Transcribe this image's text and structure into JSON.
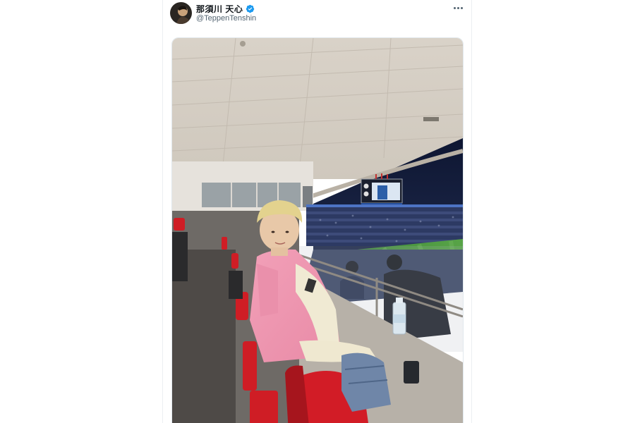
{
  "author": {
    "display_name": "那須川 天心",
    "handle": "@TeppenTenshin",
    "verified": true,
    "avatar_icon": "avatar-photo-icon"
  },
  "actions": {
    "more_icon": "more-horizontal-icon"
  },
  "colors": {
    "verified_blue": "#1d9bf0",
    "name_text": "#0f1419",
    "handle_text": "#536471"
  }
}
